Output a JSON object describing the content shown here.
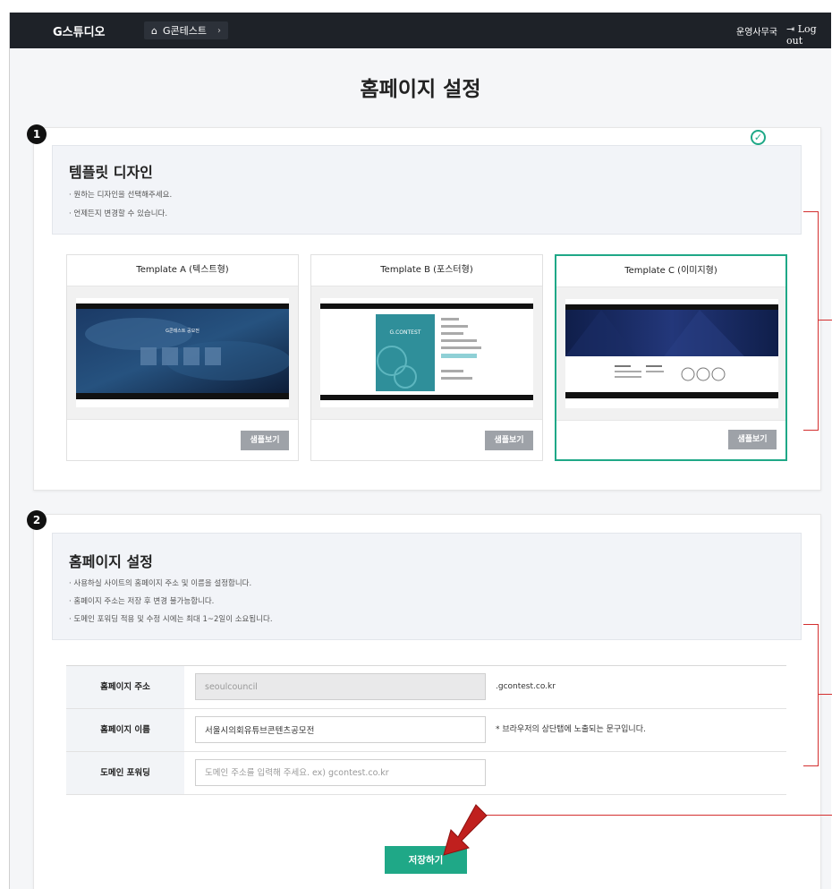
{
  "topbar": {
    "brand": "G스튜디오",
    "breadcrumb": "G콘테스트",
    "admin": "운영사무국",
    "logout": "Log out"
  },
  "page_title": "홈페이지 설정",
  "section1": {
    "badge": "1",
    "title": "템플릿 디자인",
    "lines": [
      "· 원하는 디자인을 선택해주세요.",
      "· 언제든지 변경할 수 있습니다."
    ],
    "templates": [
      {
        "name": "Template A (텍스트형)",
        "button": "샘플보기",
        "thumb_title": "G콘테스트 공모전"
      },
      {
        "name": "Template B (포스터형)",
        "button": "샘플보기",
        "thumb_title": "G.CONTEST"
      },
      {
        "name": "Template C (이미지형)",
        "button": "샘플보기",
        "selected": true
      }
    ]
  },
  "section2": {
    "badge": "2",
    "title": "홈페이지 설정",
    "lines": [
      "· 사용하실 사이트의 홈페이지 주소 및 이름을 설정합니다.",
      "· 홈페이지 주소는 저장 후 변경 불가능합니다.",
      "· 도메인 포워딩 적용 및 수정 시에는 최대 1~2일이 소요됩니다."
    ],
    "rows": [
      {
        "label": "홈페이지 주소",
        "value": "seoulcouncil",
        "placeholder": "",
        "suffix": ".gcontest.co.kr",
        "disabled": true
      },
      {
        "label": "홈페이지 이름",
        "value": "서울시의회유튜브콘텐츠공모전",
        "placeholder": "",
        "suffix": "* 브라우저의 상단탭에 노출되는 문구입니다.",
        "disabled": false
      },
      {
        "label": "도메인 포워딩",
        "value": "",
        "placeholder": "도메인 주소를 입력해 주세요. ex) gcontest.co.kr",
        "suffix": "",
        "disabled": false
      }
    ],
    "save_label": "저장하기"
  },
  "colors": {
    "accent": "#1fa887",
    "topbar": "#1e2228",
    "annotation": "#d32f2f"
  }
}
